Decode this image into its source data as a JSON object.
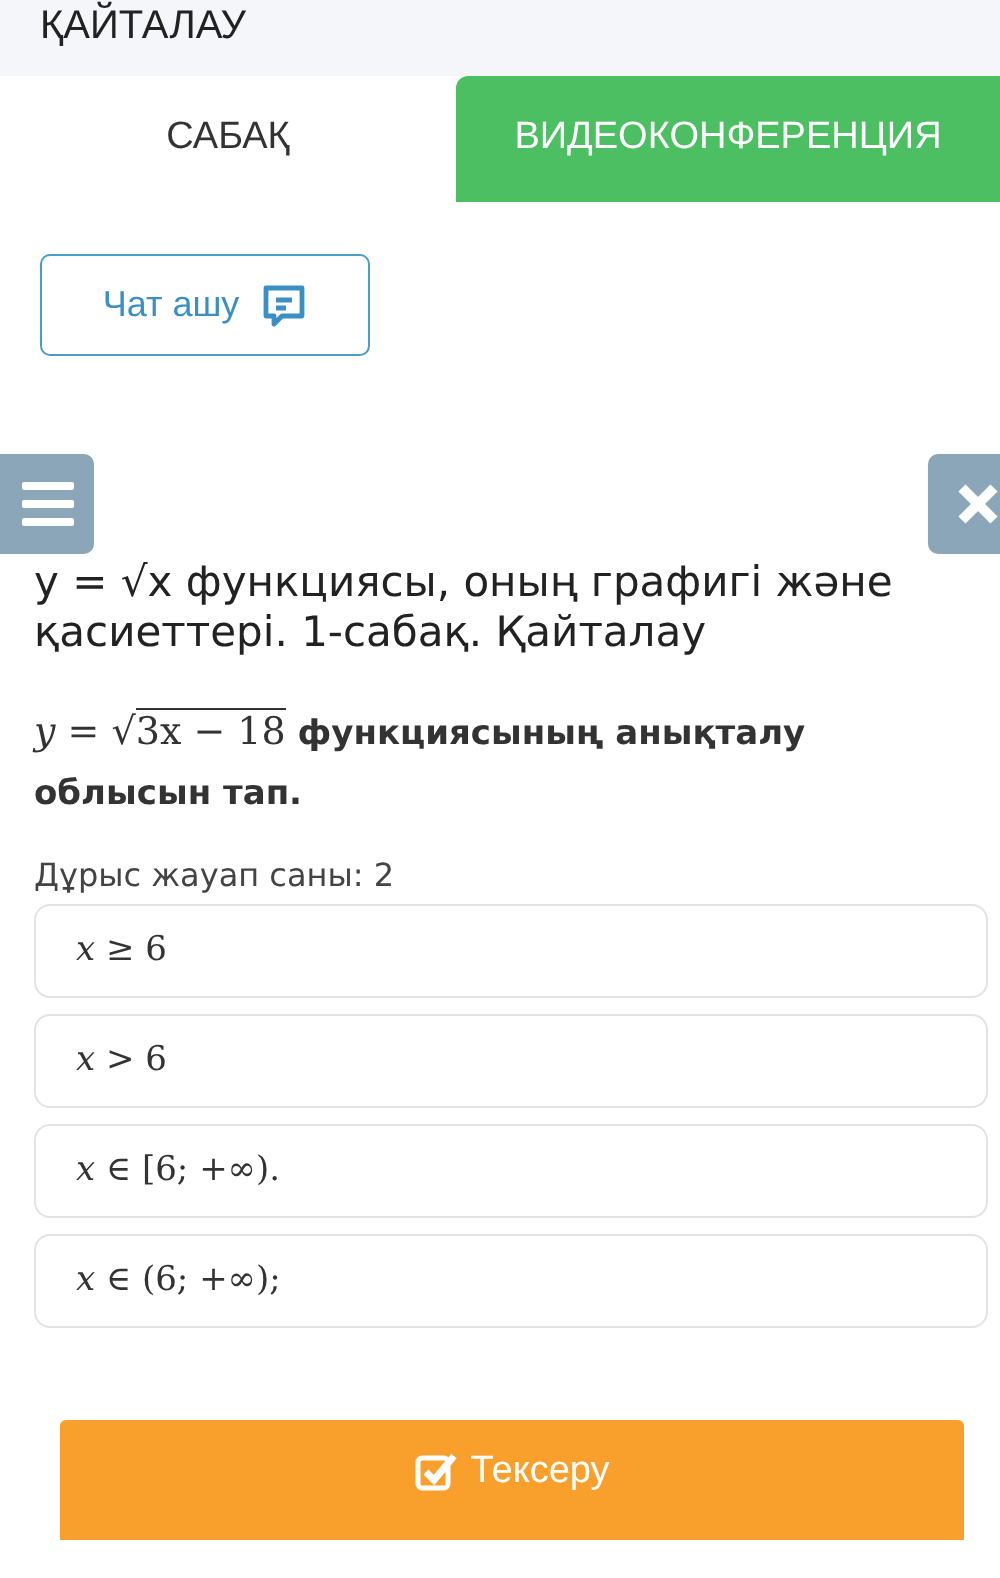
{
  "header": {
    "title": "ҚАЙТАЛАУ"
  },
  "tabs": [
    {
      "label": "САБАҚ",
      "selected": true
    },
    {
      "label": "ВИДЕОКОНФЕРЕНЦИЯ",
      "selected": false
    }
  ],
  "chat_button": {
    "label": "Чат ашу"
  },
  "lesson_title": "y = √x функциясы, оның графигі және қасиеттері. 1-сабақ. Қайталау",
  "question": {
    "lhs": "y =",
    "radical": "√",
    "radicand": "3x − 18",
    "text": "функциясының анықталу облысын тап."
  },
  "answer_count": "Дұрыс жауап саны: 2",
  "options": [
    {
      "variable": "x",
      "rest": "≥ 6"
    },
    {
      "variable": "x",
      "rest": "> 6"
    },
    {
      "variable": "x",
      "rest": "∈ [6; +∞)."
    },
    {
      "variable": "x",
      "rest": "∈ (6; +∞);"
    }
  ],
  "submit_button": {
    "label": "Тексеру"
  }
}
